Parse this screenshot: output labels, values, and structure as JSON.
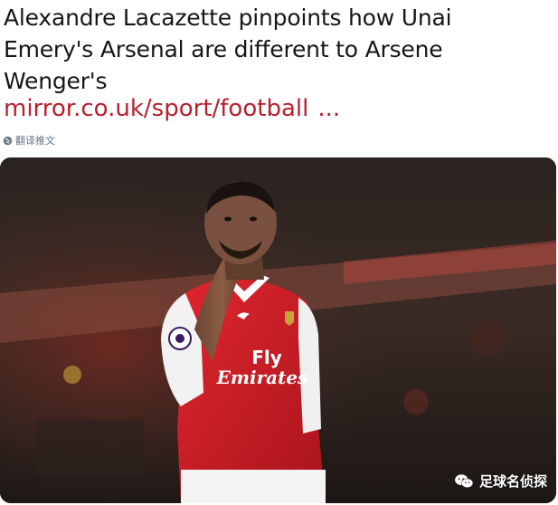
{
  "tweet": {
    "headline": "Alexandre Lacazette pinpoints how Unai Emery's Arsenal are different to Arsene Wenger's",
    "link_text": "mirror.co.uk/sport/football",
    "link_ellipsis": "...",
    "translate_label": "翻译推文"
  },
  "image": {
    "kit_sponsor_line1": "Fly",
    "kit_sponsor_line2": "Emirates",
    "watermark_label": "足球名侦探"
  },
  "colors": {
    "headline": "#14171a",
    "link": "#b8202e",
    "translate": "#657786",
    "arsenal_red": "#d3202a"
  }
}
